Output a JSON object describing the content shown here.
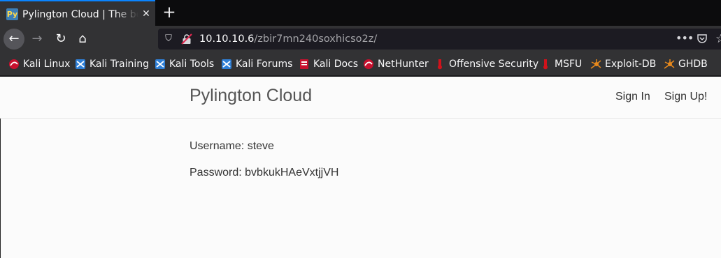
{
  "browser": {
    "tab": {
      "title": "Pylington Cloud | The best",
      "favicon": "Py",
      "close": "✕"
    },
    "new_tab": "+",
    "nav": {
      "back": "←",
      "forward": "→",
      "reload": "↻",
      "home": "⌂"
    },
    "url": {
      "host": "10.10.10.6",
      "path": "/zbir7mn240soxhicso2z/"
    },
    "url_actions": {
      "more": "•••",
      "star": "☆"
    },
    "bookmarks": [
      {
        "label": "Kali Linux",
        "icon": "kali-dragon-icon"
      },
      {
        "label": "Kali Training",
        "icon": "kali-training-icon"
      },
      {
        "label": "Kali Tools",
        "icon": "kali-tools-icon"
      },
      {
        "label": "Kali Forums",
        "icon": "kali-forums-icon"
      },
      {
        "label": "Kali Docs",
        "icon": "kali-docs-icon"
      },
      {
        "label": "NetHunter",
        "icon": "nethunter-icon"
      },
      {
        "label": "Offensive Security",
        "icon": "offsec-icon"
      },
      {
        "label": "MSFU",
        "icon": "msfu-icon"
      },
      {
        "label": "Exploit-DB",
        "icon": "exploit-db-icon"
      },
      {
        "label": "GHDB",
        "icon": "ghdb-icon"
      }
    ]
  },
  "site": {
    "brand": "Pylington Cloud",
    "nav": {
      "sign_in": "Sign In",
      "sign_up": "Sign Up!"
    },
    "credentials": {
      "username": "Username: steve",
      "password": "Password: bvbkukHAeVxtjjVH"
    }
  },
  "colors": {
    "tab_accent": "#0a84ff",
    "toolbar": "#323234",
    "page_bg": "#fbfbfb"
  }
}
